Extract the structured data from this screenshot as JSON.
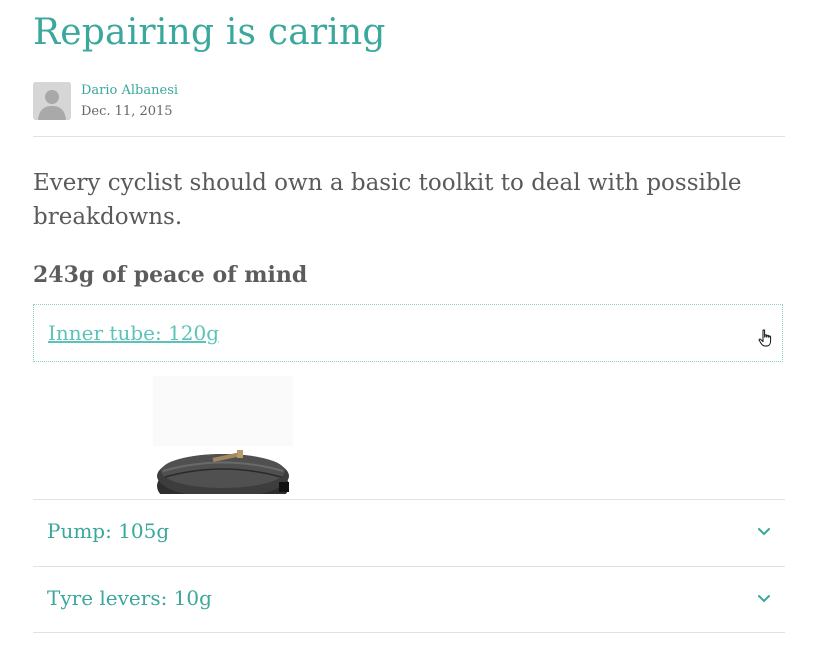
{
  "article": {
    "title": "Repairing is caring",
    "author": "Dario Albanesi",
    "date": "Dec. 11, 2015",
    "lead": "Every cyclist should own a basic toolkit to deal with possible breakdowns.",
    "section_title": "243g of peace of mind"
  },
  "accordion": {
    "items": [
      {
        "label": "Inner tube: 120g",
        "state": "expanded",
        "icon": "hand-pointer-icon"
      },
      {
        "label": "Pump: 105g",
        "state": "collapsed",
        "icon": "chevron-down-icon"
      },
      {
        "label": "Tyre levers: 10g",
        "state": "collapsed",
        "icon": "chevron-down-icon"
      }
    ]
  },
  "colors": {
    "accent": "#3aa89c",
    "accent_light": "#5cc3b8",
    "text": "#555555",
    "divider": "#e2e2e2"
  }
}
